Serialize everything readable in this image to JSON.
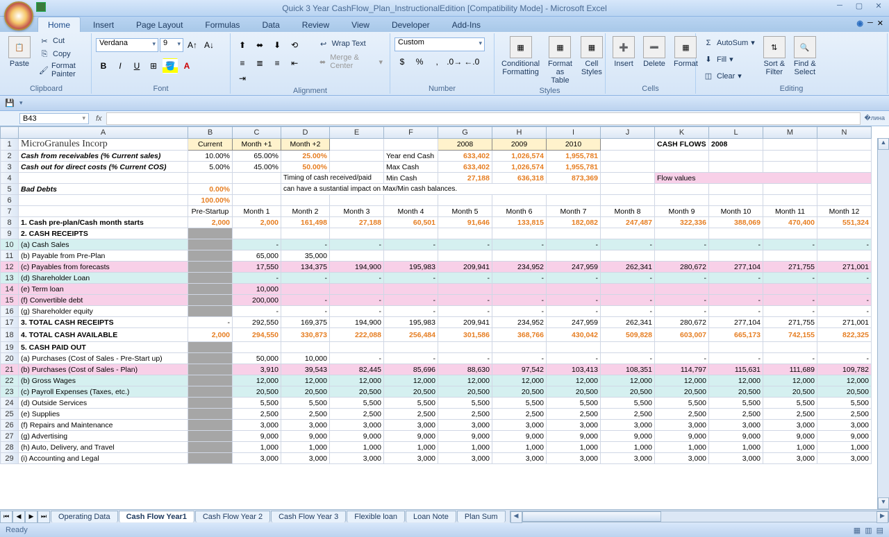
{
  "title": "Quick 3 Year CashFlow_Plan_InstructionalEdition  [Compatibility Mode] - Microsoft Excel",
  "ribbon_tabs": [
    "Home",
    "Insert",
    "Page Layout",
    "Formulas",
    "Data",
    "Review",
    "View",
    "Developer",
    "Add-Ins"
  ],
  "active_tab": "Home",
  "clipboard": {
    "paste": "Paste",
    "cut": "Cut",
    "copy": "Copy",
    "format_painter": "Format Painter",
    "label": "Clipboard"
  },
  "font": {
    "name": "Verdana",
    "size": "9",
    "label": "Font"
  },
  "alignment": {
    "wrap": "Wrap Text",
    "merge": "Merge & Center",
    "label": "Alignment"
  },
  "number": {
    "format": "Custom",
    "label": "Number"
  },
  "styles": {
    "cond": "Conditional\nFormatting",
    "fmt_table": "Format\nas Table",
    "cell_styles": "Cell\nStyles",
    "label": "Styles"
  },
  "cells": {
    "insert": "Insert",
    "delete": "Delete",
    "format": "Format",
    "label": "Cells"
  },
  "editing": {
    "autosum": "AutoSum",
    "fill": "Fill",
    "clear": "Clear",
    "sort": "Sort &\nFilter",
    "find": "Find &\nSelect",
    "label": "Editing"
  },
  "namebox": "B43",
  "cols": [
    "A",
    "B",
    "C",
    "D",
    "E",
    "F",
    "G",
    "H",
    "I",
    "J",
    "K",
    "L",
    "M",
    "N"
  ],
  "row1": {
    "a": "MicroGranules Incorp",
    "b": "Current",
    "c": "Month +1",
    "d": "Month +2",
    "g": "2008",
    "h": "2009",
    "i": "2010",
    "k": "CASH FLOWS",
    "l": "2008"
  },
  "row2": {
    "a": "Cash from receivables (% Current sales)",
    "b": "10.00%",
    "c": "65.00%",
    "d": "25.00%",
    "f": "Year end Cash",
    "g": "633,402",
    "h": "1,026,574",
    "i": "1,955,781"
  },
  "row3": {
    "a": "Cash out for direct costs (% Current COS)",
    "b": "5.00%",
    "c": "45.00%",
    "d": "50.00%",
    "f": "Max Cash",
    "g": "633,402",
    "h": "1,026,574",
    "i": "1,955,781"
  },
  "row4": {
    "e": "Timing of cash received/paid",
    "f": "Min Cash",
    "g": "27,188",
    "h": "636,318",
    "i": "873,369",
    "k": "Flow values"
  },
  "row5": {
    "a": "Bad Debts",
    "b": "0.00%",
    "e": "can have a sustantial impact on Max/Min cash balances."
  },
  "row6": {
    "b": "100.00%"
  },
  "row7": {
    "b": "Pre-Startup",
    "months": [
      "Month 1",
      "Month 2",
      "Month 3",
      "Month 4",
      "Month 5",
      "Month 6",
      "Month 7",
      "Month 8",
      "Month 9",
      "Month 10",
      "Month 11",
      "Month 12"
    ]
  },
  "row8": {
    "a": "1. Cash pre-plan/Cash month starts",
    "b": "2,000",
    "vals": [
      "2,000",
      "161,498",
      "27,188",
      "60,501",
      "91,646",
      "133,815",
      "182,082",
      "247,487",
      "322,336",
      "388,069",
      "470,400",
      "551,324"
    ]
  },
  "row9": {
    "a": "2. CASH RECEIPTS"
  },
  "row10": {
    "a": "   (a) Cash Sales",
    "vals": [
      "-",
      "-",
      "-",
      "-",
      "-",
      "-",
      "-",
      "-",
      "-",
      "-",
      "-",
      "-"
    ]
  },
  "row11": {
    "a": "   (b) Payable from Pre-Plan",
    "vals": [
      "65,000",
      "35,000",
      "",
      "",
      "",
      "",
      "",
      "",
      "",
      "",
      "",
      ""
    ]
  },
  "row12": {
    "a": "   (c) Payables from forecasts",
    "vals": [
      "17,550",
      "134,375",
      "194,900",
      "195,983",
      "209,941",
      "234,952",
      "247,959",
      "262,341",
      "280,672",
      "277,104",
      "271,755",
      "271,001"
    ]
  },
  "row13": {
    "a": "   (d) Shareholder Loan",
    "vals": [
      "-",
      "-",
      "-",
      "-",
      "-",
      "-",
      "-",
      "-",
      "-",
      "-",
      "-",
      "-"
    ]
  },
  "row14": {
    "a": "   (e) Term loan",
    "vals": [
      "10,000",
      "",
      "",
      "",
      "",
      "",
      "",
      "",
      "",
      "",
      "",
      ""
    ]
  },
  "row15": {
    "a": "   (f) Convertible debt",
    "vals": [
      "200,000",
      "-",
      "-",
      "-",
      "-",
      "-",
      "-",
      "-",
      "-",
      "-",
      "-",
      "-"
    ]
  },
  "row16": {
    "a": "   (g) Shareholder equity",
    "vals": [
      "-",
      "-",
      "-",
      "-",
      "-",
      "-",
      "-",
      "-",
      "-",
      "-",
      "-",
      "-"
    ]
  },
  "row17": {
    "a": "3. TOTAL CASH RECEIPTS",
    "b": "-",
    "vals": [
      "292,550",
      "169,375",
      "194,900",
      "195,983",
      "209,941",
      "234,952",
      "247,959",
      "262,341",
      "280,672",
      "277,104",
      "271,755",
      "271,001"
    ]
  },
  "row18": {
    "a": "4. TOTAL CASH AVAILABLE",
    "b": "2,000",
    "vals": [
      "294,550",
      "330,873",
      "222,088",
      "256,484",
      "301,586",
      "368,766",
      "430,042",
      "509,828",
      "603,007",
      "665,173",
      "742,155",
      "822,325"
    ]
  },
  "row19": {
    "a": "5. CASH PAID OUT"
  },
  "row20": {
    "a": "   (a) Purchases (Cost of Sales - Pre-Start up)",
    "vals": [
      "50,000",
      "10,000",
      "-",
      "-",
      "-",
      "-",
      "-",
      "-",
      "-",
      "-",
      "-",
      "-"
    ]
  },
  "row21": {
    "a": "   (b) Purchases (Cost of Sales - Plan)",
    "vals": [
      "3,910",
      "39,543",
      "82,445",
      "85,696",
      "88,630",
      "97,542",
      "103,413",
      "108,351",
      "114,797",
      "115,631",
      "111,689",
      "109,782"
    ]
  },
  "row22": {
    "a": "   (b) Gross Wages",
    "vals": [
      "12,000",
      "12,000",
      "12,000",
      "12,000",
      "12,000",
      "12,000",
      "12,000",
      "12,000",
      "12,000",
      "12,000",
      "12,000",
      "12,000"
    ]
  },
  "row23": {
    "a": "   (c) Payroll Expenses (Taxes, etc.)",
    "vals": [
      "20,500",
      "20,500",
      "20,500",
      "20,500",
      "20,500",
      "20,500",
      "20,500",
      "20,500",
      "20,500",
      "20,500",
      "20,500",
      "20,500"
    ]
  },
  "row24": {
    "a": "   (d) Outside Services",
    "vals": [
      "5,500",
      "5,500",
      "5,500",
      "5,500",
      "5,500",
      "5,500",
      "5,500",
      "5,500",
      "5,500",
      "5,500",
      "5,500",
      "5,500"
    ]
  },
  "row25": {
    "a": "   (e) Supplies",
    "vals": [
      "2,500",
      "2,500",
      "2,500",
      "2,500",
      "2,500",
      "2,500",
      "2,500",
      "2,500",
      "2,500",
      "2,500",
      "2,500",
      "2,500"
    ]
  },
  "row26": {
    "a": "   (f) Repairs and Maintenance",
    "vals": [
      "3,000",
      "3,000",
      "3,000",
      "3,000",
      "3,000",
      "3,000",
      "3,000",
      "3,000",
      "3,000",
      "3,000",
      "3,000",
      "3,000"
    ]
  },
  "row27": {
    "a": "   (g) Advertising",
    "vals": [
      "9,000",
      "9,000",
      "9,000",
      "9,000",
      "9,000",
      "9,000",
      "9,000",
      "9,000",
      "9,000",
      "9,000",
      "9,000",
      "9,000"
    ]
  },
  "row28": {
    "a": "   (h) Auto, Delivery, and Travel",
    "vals": [
      "1,000",
      "1,000",
      "1,000",
      "1,000",
      "1,000",
      "1,000",
      "1,000",
      "1,000",
      "1,000",
      "1,000",
      "1,000",
      "1,000"
    ]
  },
  "row29": {
    "a": "   (i) Accounting and Legal",
    "vals": [
      "3,000",
      "3,000",
      "3,000",
      "3,000",
      "3,000",
      "3,000",
      "3,000",
      "3,000",
      "3,000",
      "3,000",
      "3,000",
      "3,000"
    ]
  },
  "sheet_tabs": [
    "Operating Data",
    "Cash Flow Year1",
    "Cash Flow Year 2",
    "Cash Flow Year 3",
    "Flexible loan",
    "Loan Note",
    "Plan Sum"
  ],
  "active_sheet": "Cash Flow Year1",
  "status": "Ready"
}
